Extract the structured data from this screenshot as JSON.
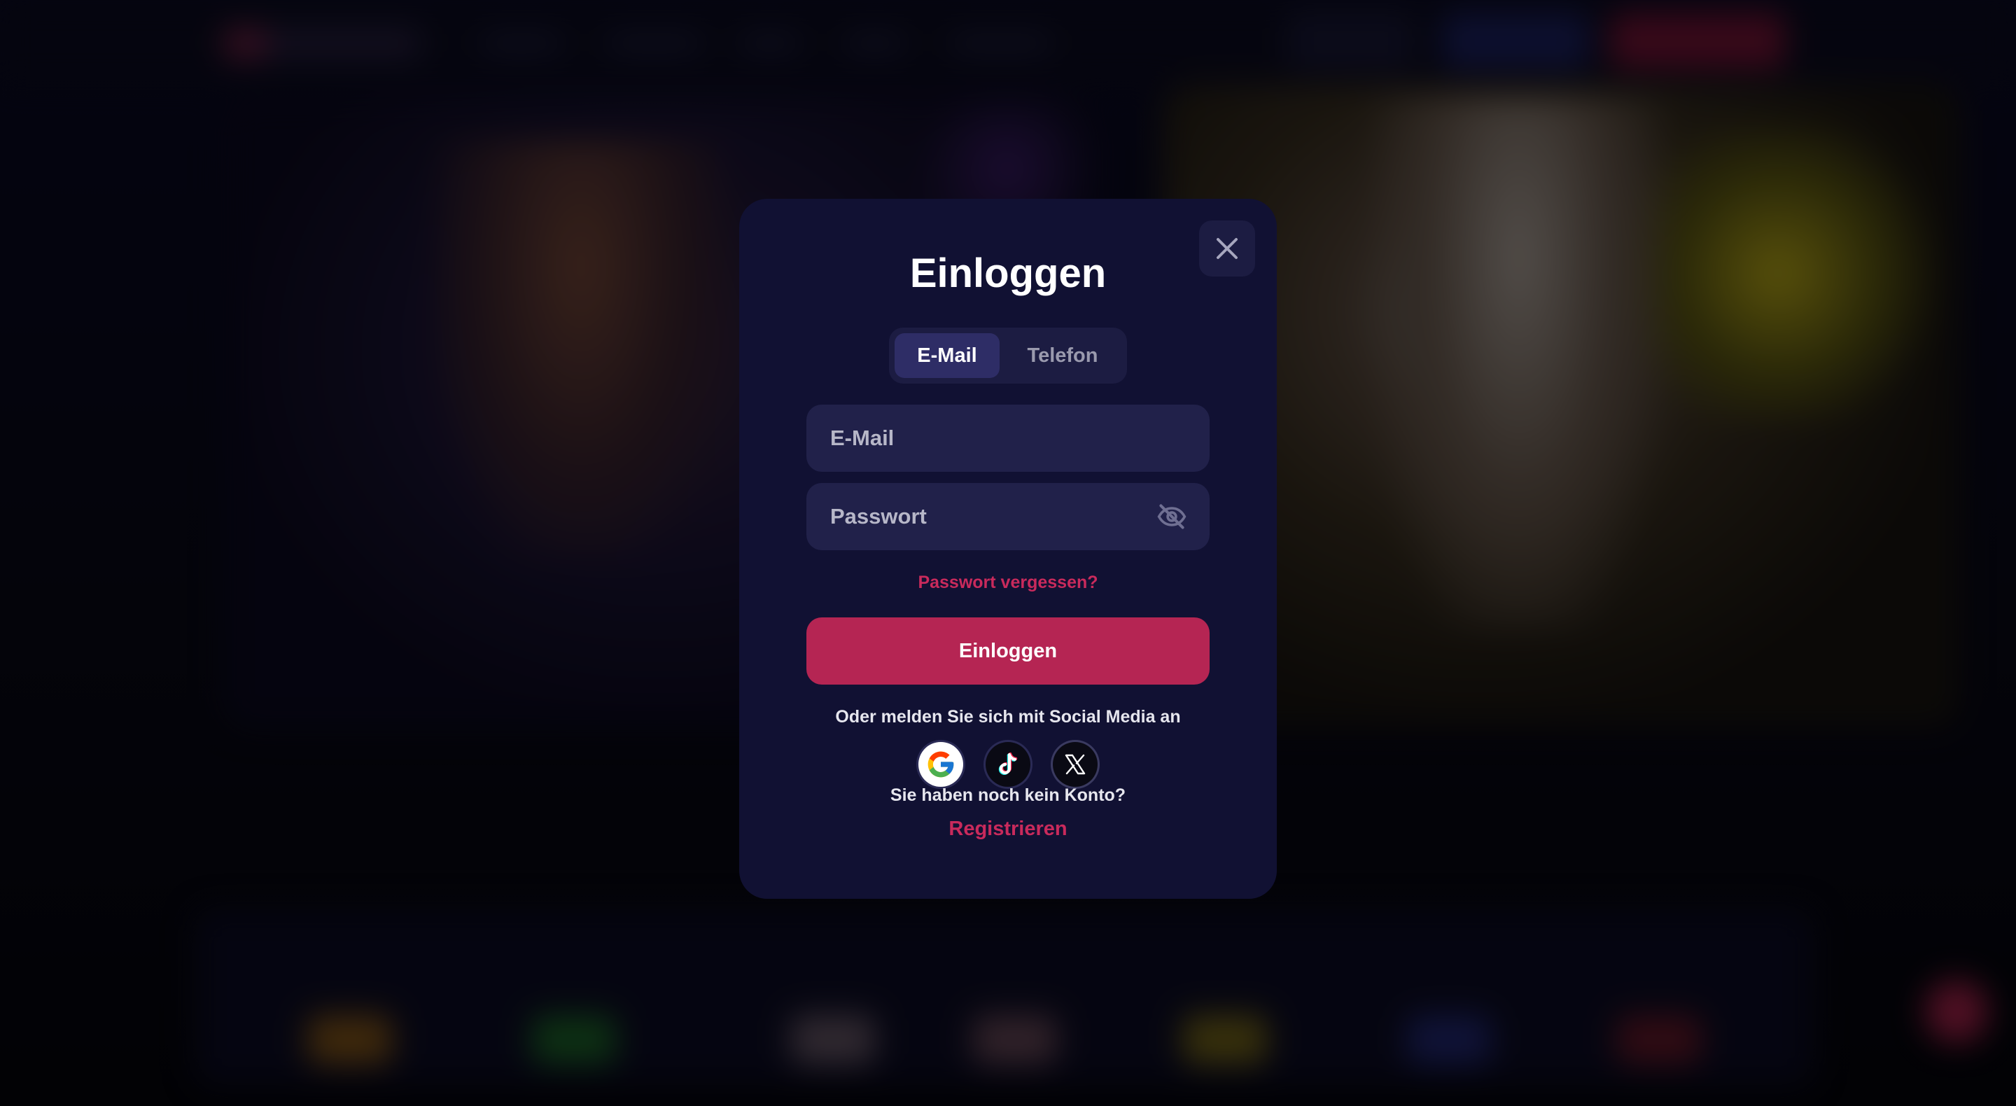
{
  "modal": {
    "title": "Einloggen",
    "tabs": [
      {
        "label": "E-Mail",
        "active": true
      },
      {
        "label": "Telefon",
        "active": false
      }
    ],
    "email": {
      "placeholder": "E-Mail",
      "value": ""
    },
    "password": {
      "placeholder": "Passwort",
      "value": ""
    },
    "forgot_password": "Passwort vergessen?",
    "login_button": "Einloggen",
    "social_prompt": "Oder melden Sie sich mit Social Media an",
    "social": [
      "google-icon",
      "tiktok-icon",
      "x-icon"
    ],
    "no_account": "Sie haben noch kein Konto?",
    "register": "Registrieren"
  },
  "colors": {
    "modal_bg": "#111133",
    "input_bg": "#21214a",
    "accent": "#b52553",
    "link": "#c92a5c"
  }
}
